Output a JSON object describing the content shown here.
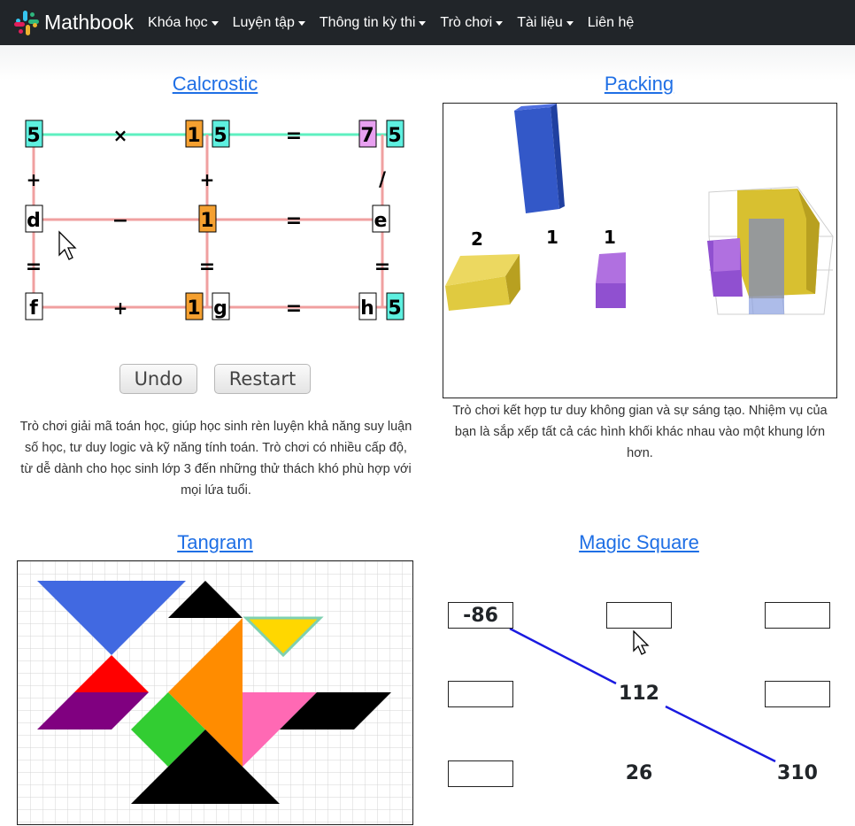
{
  "brand": {
    "name": "Mathbook"
  },
  "nav": {
    "items": [
      {
        "label": "Khóa học",
        "dropdown": true
      },
      {
        "label": "Luyện tập",
        "dropdown": true
      },
      {
        "label": "Thông tin kỳ thi",
        "dropdown": true
      },
      {
        "label": "Trò chơi",
        "dropdown": true
      },
      {
        "label": "Tài liệu",
        "dropdown": true
      },
      {
        "label": "Liên hệ",
        "dropdown": false
      }
    ]
  },
  "calcrostic": {
    "title": "Calcrostic",
    "cells": {
      "r1c1": "5",
      "r1op1": "×",
      "r1c2a": "1",
      "r1c2b": "5",
      "r1eq": "=",
      "r1c3a": "7",
      "r1c3b": "5",
      "v1a": "+",
      "v1b": "+",
      "v1c": "/",
      "r2c1": "d",
      "r2op1": "−",
      "r2c2": "1",
      "r2eq": "=",
      "r2c3": "e",
      "v2a": "=",
      "v2b": "=",
      "v2c": "=",
      "r3c1": "f",
      "r3op1": "+",
      "r3c2a": "1",
      "r3c2b": "g",
      "r3eq": "=",
      "r3c3a": "h",
      "r3c3b": "5"
    },
    "undo_label": "Undo",
    "restart_label": "Restart",
    "description": "Trò chơi giải mã toán học, giúp học sinh rèn luyện khả năng suy luận số học, tư duy logic và kỹ năng tính toán. Trò chơi có nhiều cấp độ, từ dễ dành cho học sinh lớp 3 đến những thử thách khó phù hợp với mọi lứa tuổi."
  },
  "packing": {
    "title": "Packing",
    "counts": [
      "2",
      "1",
      "1"
    ],
    "description": "Trò chơi kết hợp tư duy không gian và sự sáng tạo. Nhiệm vụ của bạn là sắp xếp tất cả các hình khối khác nhau vào một khung lớn hơn."
  },
  "tangram": {
    "title": "Tangram"
  },
  "magic_square": {
    "title": "Magic Square",
    "cells": [
      "-86",
      "",
      "",
      "",
      "112",
      "",
      "",
      "26",
      "310"
    ]
  },
  "colors": {
    "navbar": "#212529",
    "link": "#1f6fe5"
  }
}
